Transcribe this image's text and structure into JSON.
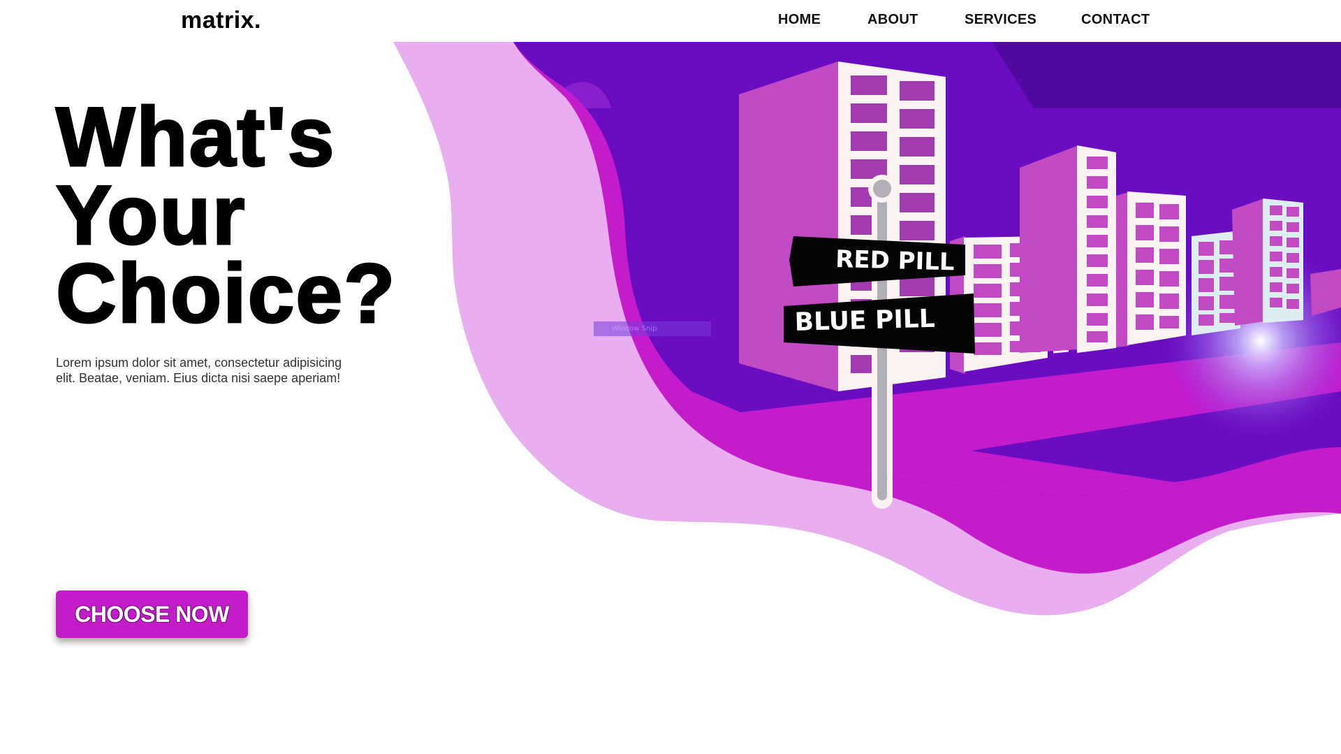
{
  "brand": {
    "logo": "matrix."
  },
  "nav": {
    "items": [
      "HOME",
      "ABOUT",
      "SERVICES",
      "CONTACT"
    ]
  },
  "hero": {
    "headline_lines": [
      "What's",
      "Your",
      "Choice?"
    ],
    "lead": "Lorem ipsum dolor sit amet, consectetur adipisicing elit. Beatae, veniam. Eius dicta nisi saepe aperiam!",
    "cta_label": "CHOOSE NOW"
  },
  "illustration": {
    "sign_top": "RED PILL",
    "sign_bottom": "BLUE PILL",
    "watermark": "Window Snip"
  },
  "colors": {
    "accent": "#c21dc9",
    "wave_light": "#e8aef0",
    "wave_mid": "#c41ccb",
    "sky_deep": "#5b0ab0",
    "building": "#c24ac4",
    "sign_black": "#050507"
  }
}
